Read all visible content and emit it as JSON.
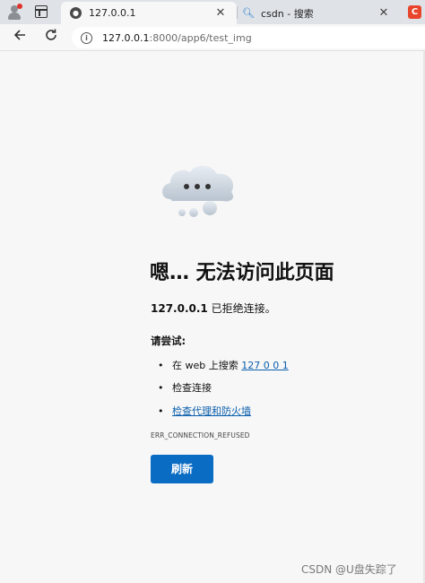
{
  "tabs": {
    "active": {
      "title": "127.0.0.1",
      "close": "✕"
    },
    "inactive": {
      "title": "csdn - 搜索",
      "close": "✕"
    }
  },
  "toolbar": {
    "url_host": "127.0.0.1",
    "url_rest": ":8000/app6/test_img"
  },
  "error": {
    "heading": "嗯… 无法访问此页面",
    "host": "127.0.0.1",
    "desc_suffix": " 已拒绝连接。",
    "try_label": "请尝试:",
    "suggestions": {
      "s1_prefix": "在 web 上搜索 ",
      "s1_link": "127 0 0 1",
      "s2": "检查连接",
      "s3": "检查代理和防火墙"
    },
    "code": "ERR_CONNECTION_REFUSED",
    "refresh_label": "刷新"
  },
  "watermark": "CSDN @U盘失踪了",
  "icons": {
    "profile": "profile-avatar-icon",
    "tab_actions": "tab-actions-icon",
    "back": "back-arrow-icon",
    "reload": "reload-icon",
    "site_info": "site-info-icon",
    "cloud": "cloud-error-icon",
    "search": "search-icon",
    "extension": "extension-icon"
  },
  "colors": {
    "link": "#0b5fad",
    "button": "#0b6cc4",
    "tabstrip": "#dfe3e8"
  }
}
